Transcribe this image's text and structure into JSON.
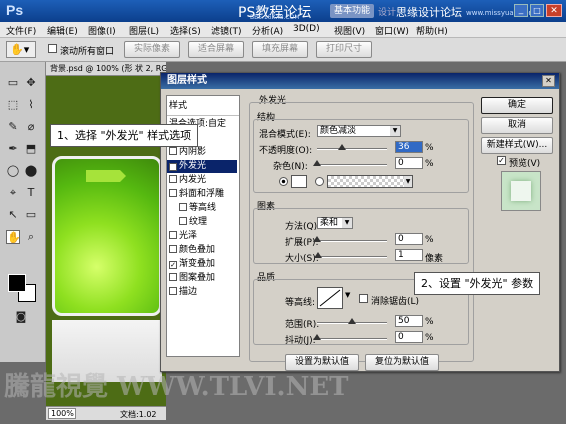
{
  "app": {
    "logo": "Ps",
    "watermark_top": "PS教程论坛",
    "watermark_top_sub": "BBS.16XX8.COM",
    "watermark_right": "思缘设计论坛",
    "watermark_right_sub": "www.missyuan.com",
    "badge": "基本功能",
    "design": "设计"
  },
  "menu": [
    "文件(F)",
    "编辑(E)",
    "图像(I)",
    "图层(L)",
    "选择(S)",
    "滤镜(T)",
    "分析(A)",
    "3D(D)",
    "视图(V)",
    "窗口(W)",
    "帮助(H)"
  ],
  "options": {
    "scroll_all": "滚动所有窗口",
    "actual": "实际像素",
    "fit": "适合屏幕",
    "fill": "填充屏幕",
    "print": "打印尺寸"
  },
  "document": {
    "tab": "背景.psd @ 100% (形 状 2, RGB/8#)",
    "zoom": "100%",
    "status": "文档:1.02"
  },
  "dialog": {
    "title": "图层样式",
    "styles_header": "样式",
    "blend_options": "混合选项:自定",
    "items": [
      {
        "label": "投影",
        "checked": false,
        "indent": false
      },
      {
        "label": "内阴影",
        "checked": false,
        "indent": false
      },
      {
        "label": "外发光",
        "checked": true,
        "indent": false
      },
      {
        "label": "内发光",
        "checked": false,
        "indent": false
      },
      {
        "label": "斜面和浮雕",
        "checked": false,
        "indent": false
      },
      {
        "label": "等高线",
        "checked": false,
        "indent": true
      },
      {
        "label": "纹理",
        "checked": false,
        "indent": true
      },
      {
        "label": "光泽",
        "checked": false,
        "indent": false
      },
      {
        "label": "颜色叠加",
        "checked": false,
        "indent": false
      },
      {
        "label": "渐变叠加",
        "checked": true,
        "indent": false
      },
      {
        "label": "图案叠加",
        "checked": false,
        "indent": false
      },
      {
        "label": "描边",
        "checked": false,
        "indent": false
      }
    ],
    "outer_glow": "外发光",
    "structure": {
      "title": "结构",
      "blend_label": "混合模式(E):",
      "blend_value": "颜色减淡",
      "opacity_label": "不透明度(O):",
      "opacity_value": "36",
      "opacity": 0.36,
      "noise_label": "杂色(N):",
      "noise_value": "0",
      "noise": 0,
      "percent": "%"
    },
    "elements": {
      "title": "图素",
      "method_label": "方法(Q):",
      "method_value": "柔和",
      "spread_label": "扩展(P):",
      "spread_value": "0",
      "spread": 0,
      "size_label": "大小(S):",
      "size_value": "1",
      "size": 0.01,
      "unit_px": "像素"
    },
    "quality": {
      "title": "品质",
      "contour_label": "等高线:",
      "antialias_label": "消除锯齿(L)",
      "range_label": "范围(R):",
      "range_value": "50",
      "range": 0.5,
      "jitter_label": "抖动(J):",
      "jitter_value": "0",
      "jitter": 0
    },
    "default_set": "设置为默认值",
    "default_reset": "复位为默认值",
    "ok": "确定",
    "cancel": "取消",
    "new_style": "新建样式(W)...",
    "preview": "预览(V)"
  },
  "callouts": {
    "step1": "1、选择 \"外发光\" 样式选项",
    "step2": "2、设置 \"外发光\" 参数"
  },
  "watermark_bottom": "騰龍視覺 WWW.TLVI.NET"
}
